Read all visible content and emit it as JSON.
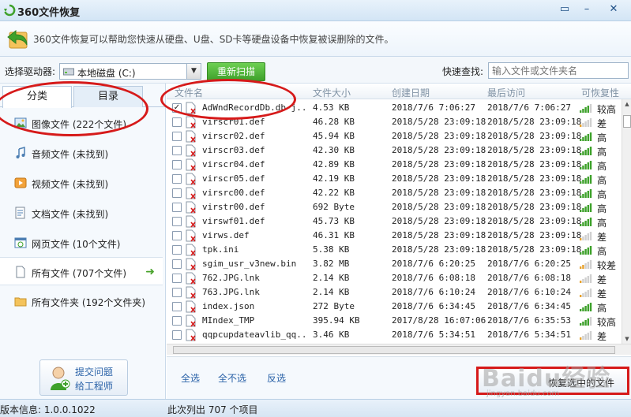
{
  "window": {
    "title": "360文件恢复",
    "buttons": [
      "restore-down",
      "minimize",
      "close"
    ]
  },
  "banner": {
    "text": "360文件恢复可以帮助您快速从硬盘、U盘、SD卡等硬盘设备中恢复被误删除的文件。"
  },
  "toolbar": {
    "drive_label": "选择驱动器:",
    "drive_value": "本地磁盘 (C:)",
    "rescan_label": "重新扫描",
    "search_label": "快速查找:",
    "search_placeholder": "输入文件或文件夹名"
  },
  "sidebar": {
    "tabs": [
      {
        "label": "分类",
        "active": true
      },
      {
        "label": "目录",
        "active": false
      }
    ],
    "categories": [
      {
        "label": "图像文件 (222个文件)",
        "icon": "image-icon"
      },
      {
        "label": "音频文件 (未找到)",
        "icon": "music-icon"
      },
      {
        "label": "视频文件 (未找到)",
        "icon": "video-icon"
      },
      {
        "label": "文档文件 (未找到)",
        "icon": "document-icon"
      },
      {
        "label": "网页文件 (10个文件)",
        "icon": "web-icon"
      },
      {
        "label": "所有文件 (707个文件)",
        "icon": "file-icon",
        "selected": true
      },
      {
        "label": "所有文件夹 (192个文件夹)",
        "icon": "folder-icon"
      }
    ],
    "feedback": {
      "line1": "提交问题",
      "line2": "给工程师"
    }
  },
  "table": {
    "columns": [
      "文件名",
      "文件大小",
      "创建日期",
      "最后访问",
      "可恢复性"
    ],
    "rows": [
      {
        "name": "AdWndRecordDb.db-j...",
        "size": "4.53 KB",
        "created": "2018/7/6 7:06:27",
        "accessed": "2018/7/6 7:06:27",
        "quality": "较高",
        "level": 4,
        "checked": true
      },
      {
        "name": "virscr01.def",
        "size": "46.28 KB",
        "created": "2018/5/28 23:09:18",
        "accessed": "2018/5/28 23:09:18",
        "quality": "差",
        "level": 1,
        "checked": false
      },
      {
        "name": "virscr02.def",
        "size": "45.94 KB",
        "created": "2018/5/28 23:09:18",
        "accessed": "2018/5/28 23:09:18",
        "quality": "高",
        "level": 5,
        "checked": false
      },
      {
        "name": "virscr03.def",
        "size": "42.30 KB",
        "created": "2018/5/28 23:09:18",
        "accessed": "2018/5/28 23:09:18",
        "quality": "高",
        "level": 5,
        "checked": false
      },
      {
        "name": "virscr04.def",
        "size": "42.89 KB",
        "created": "2018/5/28 23:09:18",
        "accessed": "2018/5/28 23:09:18",
        "quality": "高",
        "level": 5,
        "checked": false
      },
      {
        "name": "virscr05.def",
        "size": "42.19 KB",
        "created": "2018/5/28 23:09:18",
        "accessed": "2018/5/28 23:09:18",
        "quality": "高",
        "level": 5,
        "checked": false
      },
      {
        "name": "virsrc00.def",
        "size": "42.22 KB",
        "created": "2018/5/28 23:09:18",
        "accessed": "2018/5/28 23:09:18",
        "quality": "高",
        "level": 5,
        "checked": false
      },
      {
        "name": "virstr00.def",
        "size": "692 Byte",
        "created": "2018/5/28 23:09:18",
        "accessed": "2018/5/28 23:09:18",
        "quality": "高",
        "level": 5,
        "checked": false
      },
      {
        "name": "virswf01.def",
        "size": "45.73 KB",
        "created": "2018/5/28 23:09:18",
        "accessed": "2018/5/28 23:09:18",
        "quality": "高",
        "level": 5,
        "checked": false
      },
      {
        "name": "virws.def",
        "size": "46.31 KB",
        "created": "2018/5/28 23:09:18",
        "accessed": "2018/5/28 23:09:18",
        "quality": "差",
        "level": 1,
        "checked": false
      },
      {
        "name": "tpk.ini",
        "size": "5.38 KB",
        "created": "2018/5/28 23:09:18",
        "accessed": "2018/5/28 23:09:18",
        "quality": "高",
        "level": 5,
        "checked": false
      },
      {
        "name": "sgim_usr_v3new.bin",
        "size": "3.82 MB",
        "created": "2018/7/6 6:20:25",
        "accessed": "2018/7/6 6:20:25",
        "quality": "较差",
        "level": 2,
        "checked": false
      },
      {
        "name": "762.JPG.lnk",
        "size": "2.14 KB",
        "created": "2018/7/6 6:08:18",
        "accessed": "2018/7/6 6:08:18",
        "quality": "差",
        "level": 1,
        "checked": false
      },
      {
        "name": "763.JPG.lnk",
        "size": "2.14 KB",
        "created": "2018/7/6 6:10:24",
        "accessed": "2018/7/6 6:10:24",
        "quality": "差",
        "level": 1,
        "checked": false
      },
      {
        "name": "index.json",
        "size": "272 Byte",
        "created": "2018/7/6 6:34:45",
        "accessed": "2018/7/6 6:34:45",
        "quality": "高",
        "level": 5,
        "checked": false
      },
      {
        "name": "MIndex_TMP",
        "size": "395.94 KB",
        "created": "2017/8/28 16:07:06",
        "accessed": "2018/7/6 6:35:53",
        "quality": "较高",
        "level": 4,
        "checked": false
      },
      {
        "name": "qqpcupdateavlib_qq...",
        "size": "3.46 KB",
        "created": "2018/7/6 5:34:51",
        "accessed": "2018/7/6 5:34:51",
        "quality": "差",
        "level": 1,
        "checked": false
      }
    ]
  },
  "bottom": {
    "select_all": "全选",
    "select_none": "全不选",
    "invert": "反选",
    "recover_label": "恢复选中的文件"
  },
  "status": {
    "version": "版本信息: 1.0.0.1022",
    "listed": "此次列出 707 个项目"
  },
  "watermark": {
    "main": "Baidu经验",
    "sub": "jingyan.baidu.com"
  },
  "colors": {
    "accent_green": "#3ea12b",
    "highlight_red": "#d61a1a",
    "link_blue": "#2a62a8"
  }
}
